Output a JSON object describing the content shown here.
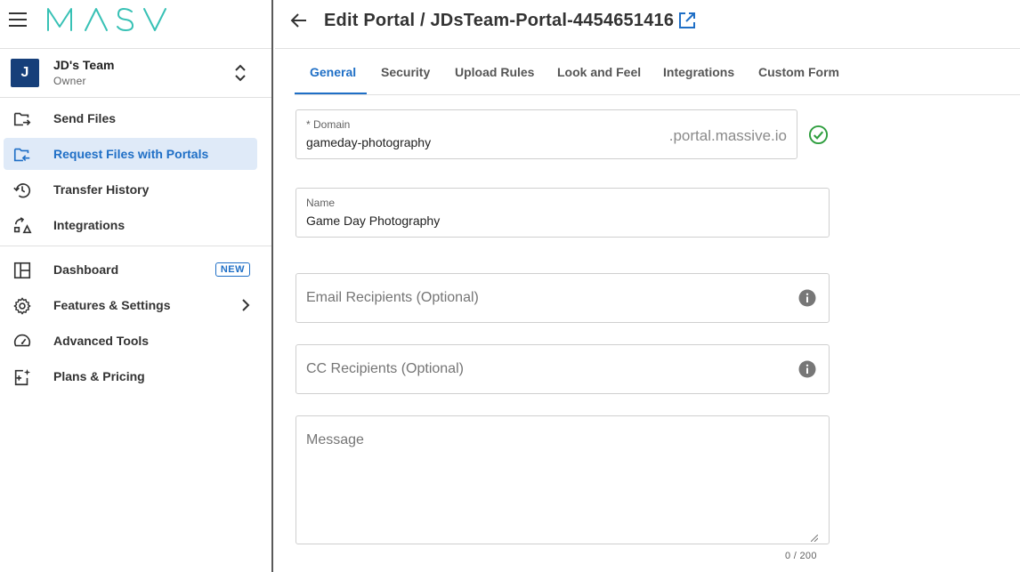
{
  "brand": {
    "logo_text": "MASV",
    "accent": "#1f6fc6",
    "logo_color": "#37c1b5"
  },
  "team": {
    "initial": "J",
    "name": "JD's Team",
    "role": "Owner"
  },
  "nav": {
    "primary": [
      {
        "label": "Send Files",
        "icon": "send-files-icon"
      },
      {
        "label": "Request Files with Portals",
        "icon": "request-files-icon",
        "active": true
      },
      {
        "label": "Transfer History",
        "icon": "history-icon"
      },
      {
        "label": "Integrations",
        "icon": "integrations-icon"
      }
    ],
    "secondary": [
      {
        "label": "Dashboard",
        "icon": "dashboard-icon",
        "badge": "NEW"
      },
      {
        "label": "Features & Settings",
        "icon": "gear-icon"
      },
      {
        "label": "Advanced Tools",
        "icon": "gauge-icon"
      },
      {
        "label": "Plans & Pricing",
        "icon": "plans-icon"
      }
    ]
  },
  "header": {
    "title": "Edit Portal / JDsTeam-Portal-4454651416"
  },
  "tabs": [
    "General",
    "Security",
    "Upload Rules",
    "Look and Feel",
    "Integrations",
    "Custom Form"
  ],
  "form": {
    "domain": {
      "label": "* Domain",
      "value": "gameday-photography",
      "suffix": ".portal.massive.io",
      "status": "valid"
    },
    "name": {
      "label": "Name",
      "value": "Game Day Photography"
    },
    "email": {
      "placeholder": "Email Recipients (Optional)"
    },
    "cc": {
      "placeholder": "CC Recipients (Optional)"
    },
    "message": {
      "placeholder": "Message",
      "counter": "0 / 200"
    }
  },
  "colors": {
    "active_bg": "#dfeaf8",
    "success": "#2e9e3e",
    "info_icon": "#777777"
  }
}
